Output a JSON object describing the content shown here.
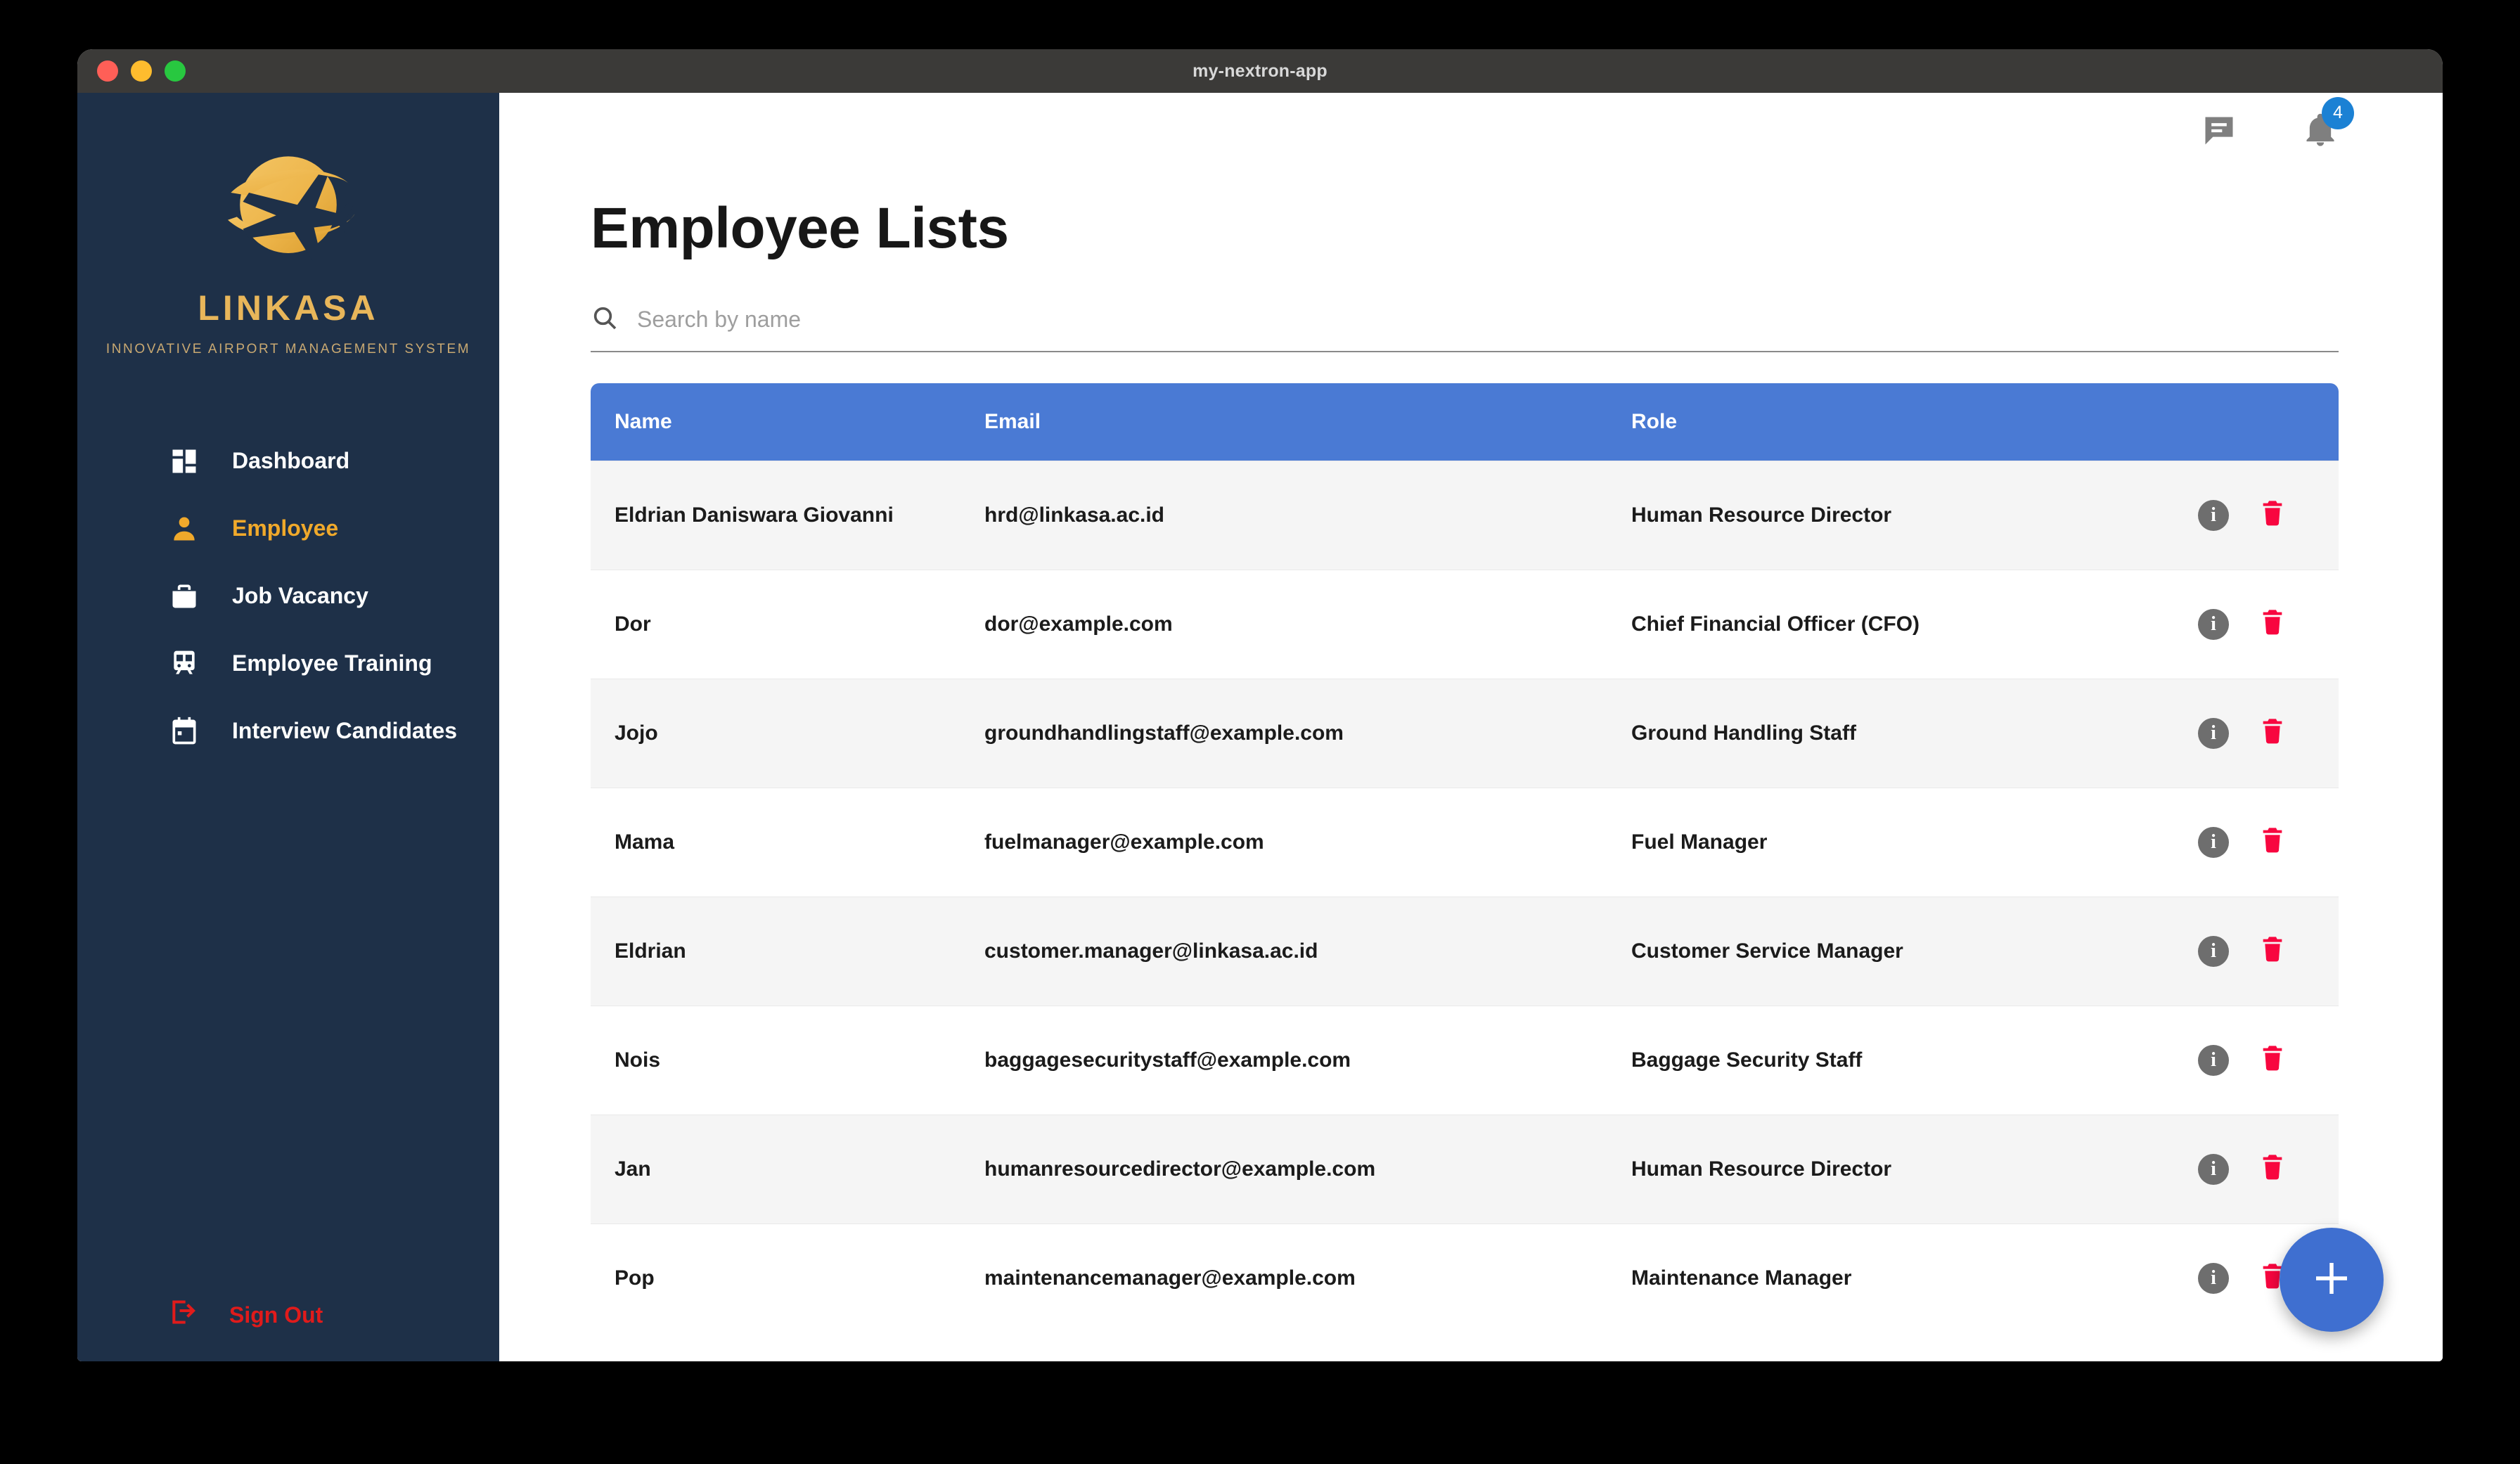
{
  "window": {
    "title": "my-nextron-app",
    "traffic_lights": [
      "close",
      "minimize",
      "zoom"
    ]
  },
  "sidebar": {
    "brand_name": "LINKASA",
    "brand_tagline": "INNOVATIVE AIRPORT MANAGEMENT SYSTEM",
    "nav_items": [
      {
        "label": "Dashboard",
        "icon": "dashboard-icon",
        "active": false
      },
      {
        "label": "Employee",
        "icon": "person-icon",
        "active": true
      },
      {
        "label": "Job Vacancy",
        "icon": "briefcase-icon",
        "active": false
      },
      {
        "label": "Employee Training",
        "icon": "tram-icon",
        "active": false
      },
      {
        "label": "Interview Candidates",
        "icon": "calendar-icon",
        "active": false
      }
    ],
    "signout_label": "Sign Out",
    "colors": {
      "background": "#1e3048",
      "accent": "#f0a92b",
      "signout": "#e01b1b"
    }
  },
  "topbar": {
    "chat_icon": "chat-bubble-icon",
    "notification_icon": "bell-icon",
    "notification_count": "4",
    "badge_color": "#1b81d4"
  },
  "page": {
    "title": "Employee Lists"
  },
  "search": {
    "placeholder": "Search by name",
    "value": "",
    "icon": "search-icon"
  },
  "table": {
    "header_color": "#4a7ad4",
    "columns": [
      "Name",
      "Email",
      "Role"
    ],
    "rows": [
      {
        "name": "Eldrian Daniswara Giovanni",
        "email": "hrd@linkasa.ac.id",
        "role": "Human Resource Director"
      },
      {
        "name": "Dor",
        "email": "dor@example.com",
        "role": "Chief Financial Officer (CFO)"
      },
      {
        "name": "Jojo",
        "email": "groundhandlingstaff@example.com",
        "role": "Ground Handling Staff"
      },
      {
        "name": "Mama",
        "email": "fuelmanager@example.com",
        "role": "Fuel Manager"
      },
      {
        "name": "Eldrian",
        "email": "customer.manager@linkasa.ac.id",
        "role": "Customer Service Manager"
      },
      {
        "name": "Nois",
        "email": "baggagesecuritystaff@example.com",
        "role": "Baggage Security Staff"
      },
      {
        "name": "Jan",
        "email": "humanresourcedirector@example.com",
        "role": "Human Resource Director"
      },
      {
        "name": "Pop",
        "email": "maintenancemanager@example.com",
        "role": "Maintenance Manager"
      }
    ],
    "row_actions": {
      "info_label": "i",
      "info_icon": "info-icon",
      "delete_icon": "trash-icon"
    }
  },
  "fab": {
    "icon": "plus-icon",
    "color": "#3f6fd0"
  }
}
